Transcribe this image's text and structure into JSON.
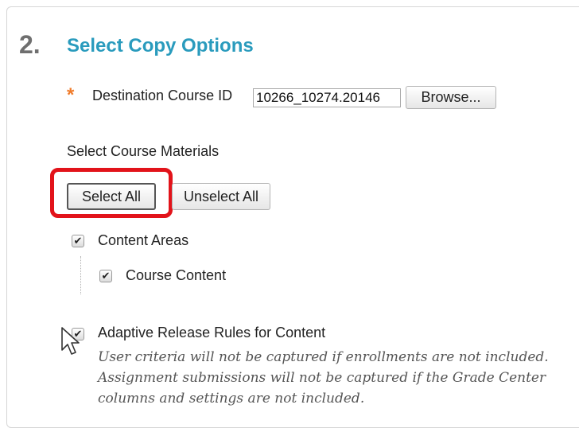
{
  "section": {
    "step_number": "2.",
    "title": "Select Copy Options"
  },
  "destination": {
    "required_mark": "*",
    "label": "Destination Course ID",
    "value": "10266_10274.20146",
    "browse_label": "Browse..."
  },
  "materials": {
    "label": "Select Course Materials",
    "select_all_label": "Select All",
    "unselect_all_label": "Unselect All",
    "items": [
      {
        "label": "Content Areas",
        "checked": true
      },
      {
        "label": "Course Content",
        "checked": true
      },
      {
        "label": "Adaptive Release Rules for Content",
        "checked": true
      }
    ],
    "note": "User criteria will not be captured if enrollments are not included. Assignment submissions will not be captured if the Grade Center columns and settings are not included."
  },
  "colors": {
    "title": "#2a9bbd",
    "required": "#f07b2a",
    "highlight": "#e2131a"
  },
  "icons": {
    "checkmark": "✔",
    "cursor": "arrow-cursor-icon"
  }
}
